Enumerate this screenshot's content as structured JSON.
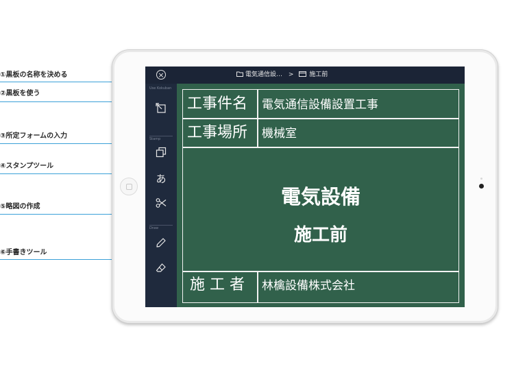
{
  "annotations": [
    {
      "label": "①黒板の名称を決める"
    },
    {
      "label": "②黒板を使う"
    },
    {
      "label": "③所定フォームの入力"
    },
    {
      "label": "④スタンプツール"
    },
    {
      "label": "⑤略図の作成"
    },
    {
      "label": "⑥手書きツール"
    }
  ],
  "topbar": {
    "close_icon": "×",
    "folder_label": "電気通信設…",
    "separator": ">",
    "board_label": "施工前"
  },
  "sidebar": {
    "section_use": "Use Kokuban",
    "section_stamp": "Stamp",
    "section_draw": "Draw",
    "tool_kana": "あ"
  },
  "board": {
    "row1_label": "工事件名",
    "row1_value": "電気通信設備設置工事",
    "row2_label": "工事場所",
    "row2_value": "機械室",
    "main_line1": "電気設備",
    "main_line2": "施工前",
    "row4_label": "施 工 者",
    "row4_value": "林檎設備株式会社"
  },
  "colors": {
    "board_green": "#31614b",
    "sidebar_navy": "#1f2a3d",
    "annotation_blue": "#3aa0d8"
  }
}
